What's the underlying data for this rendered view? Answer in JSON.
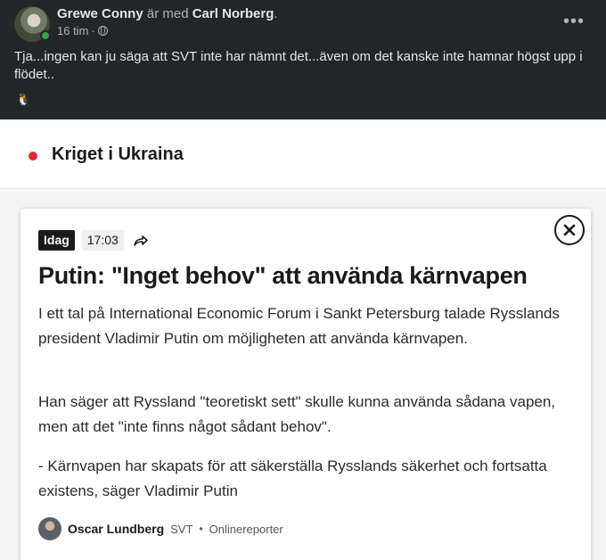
{
  "post": {
    "author": "Grewe Conny",
    "with_text": "är med",
    "tagged": "Carl Norberg",
    "period": ".",
    "time": "16 tim",
    "dot": "·",
    "more": "•••",
    "text": "Tja...ingen kan ju säga att SVT inte har nämnt det...även om det kanske inte hamnar högst upp i flödet..",
    "emoji": "🐧"
  },
  "svt": {
    "topic": "Kriget i Ukraina",
    "accent_color": "#e0253a",
    "card": {
      "badge": "Idag",
      "time": "17:03",
      "headline": "Putin: \"Inget behov\" att använda kärnvapen",
      "paragraphs": [
        "I ett tal på International Economic Forum i Sankt Petersburg talade Rysslands president Vladimir Putin om möjligheten att använda kärnvapen.",
        "Han säger att Ryssland \"teoretiskt sett\" skulle kunna använda sådana vapen, men att det \"inte finns något sådant behov\".",
        "- Kärnvapen har skapats för att säkerställa Rysslands säkerhet och fortsatta existens, säger Vladimir Putin"
      ],
      "author": {
        "name": "Oscar Lundberg",
        "org": "SVT",
        "separator": "•",
        "role": "Onlinereporter"
      }
    }
  },
  "icons": [
    "globe-icon",
    "more-icon",
    "close-icon",
    "share-icon",
    "topic-dot-icon"
  ]
}
